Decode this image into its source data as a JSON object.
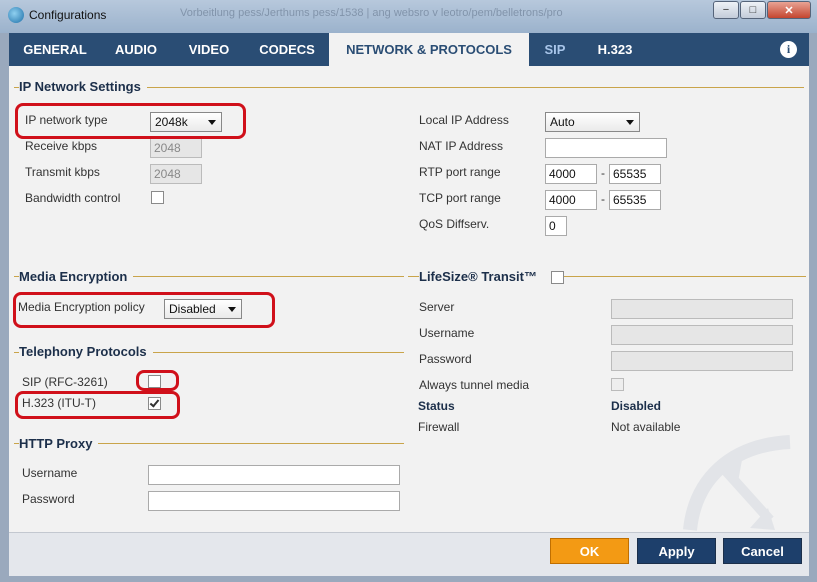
{
  "window": {
    "title": "Configurations",
    "ghost_text": "Vorbeitlung pess/Jerthums pess/1538 | ang websro v leotro/pem/belletrons/pro",
    "minimize": "−",
    "maximize": "□",
    "close": "✕"
  },
  "tabs": [
    {
      "label": "GENERAL"
    },
    {
      "label": "AUDIO"
    },
    {
      "label": "VIDEO"
    },
    {
      "label": "CODECS"
    },
    {
      "label": "NETWORK & PROTOCOLS"
    },
    {
      "label": "SIP"
    },
    {
      "label": "H.323"
    }
  ],
  "info_glyph": "i",
  "ip_network": {
    "title": "IP Network Settings",
    "network_type_label": "IP network type",
    "network_type_value": "2048k",
    "receive_label": "Receive kbps",
    "receive_value": "2048",
    "transmit_label": "Transmit kbps",
    "transmit_value": "2048",
    "bandwidth_label": "Bandwidth control",
    "local_ip_label": "Local IP Address",
    "local_ip_value": "Auto",
    "nat_ip_label": "NAT IP Address",
    "nat_ip_value": "",
    "rtp_label": "RTP port range",
    "rtp_from": "4000",
    "rtp_to": "65535",
    "tcp_label": "TCP port range",
    "tcp_from": "4000",
    "tcp_to": "65535",
    "qos_label": "QoS Diffserv.",
    "qos_value": "0",
    "range_sep": "-"
  },
  "media_encryption": {
    "title": "Media Encryption",
    "policy_label": "Media Encryption policy",
    "policy_value": "Disabled"
  },
  "telephony": {
    "title": "Telephony Protocols",
    "sip_label": "SIP (RFC-3261)",
    "sip_checked": false,
    "h323_label": "H.323 (ITU-T)",
    "h323_checked": true
  },
  "http_proxy": {
    "title": "HTTP Proxy",
    "username_label": "Username",
    "username_value": "",
    "password_label": "Password",
    "password_value": ""
  },
  "transit": {
    "title": "LifeSize® Transit™",
    "server_label": "Server",
    "username_label": "Username",
    "password_label": "Password",
    "tunnel_label": "Always tunnel media",
    "status_label": "Status",
    "status_value": "Disabled",
    "firewall_label": "Firewall",
    "firewall_value": "Not available"
  },
  "footer": {
    "ok": "OK",
    "apply": "Apply",
    "cancel": "Cancel"
  },
  "colors": {
    "tabbar": "#2a4d74",
    "ok_button": "#f39a14",
    "annotation_red": "#d0101a",
    "section_rule": "#c9a44a"
  }
}
